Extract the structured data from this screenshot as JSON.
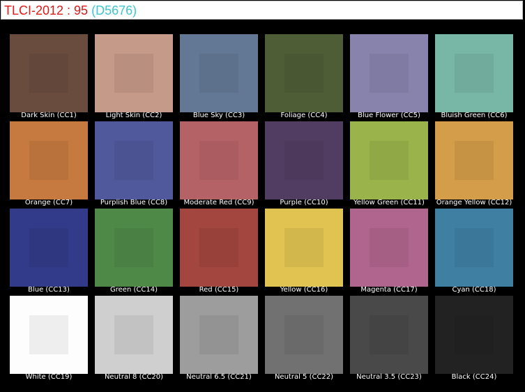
{
  "title": {
    "metric": "TLCI-2012 : 95",
    "source": "(D5676)",
    "metric_color": "#e01818",
    "source_color": "#3cc8d2"
  },
  "patches": [
    {
      "label": "Dark Skin (CC1)",
      "color": "#694c3e"
    },
    {
      "label": "Light Skin (CC2)",
      "color": "#c59a88"
    },
    {
      "label": "Blue Sky (CC3)",
      "color": "#637895"
    },
    {
      "label": "Foliage (CC4)",
      "color": "#4f5d37"
    },
    {
      "label": "Blue Flower (CC5)",
      "color": "#8883ad"
    },
    {
      "label": "Bluish Green (CC6)",
      "color": "#78b6a6"
    },
    {
      "label": "Orange (CC7)",
      "color": "#c67a40"
    },
    {
      "label": "Purplish Blue (CC8)",
      "color": "#51599d"
    },
    {
      "label": "Moderate Red (CC9)",
      "color": "#b56266"
    },
    {
      "label": "Purple (CC10)",
      "color": "#523d62"
    },
    {
      "label": "Yellow Green (CC11)",
      "color": "#9bb34b"
    },
    {
      "label": "Orange Yellow (CC12)",
      "color": "#d39d4a"
    },
    {
      "label": "Blue (CC13)",
      "color": "#313b89"
    },
    {
      "label": "Green (CC14)",
      "color": "#4f8948"
    },
    {
      "label": "Red (CC15)",
      "color": "#a2463f"
    },
    {
      "label": "Yellow (CC16)",
      "color": "#e0c351"
    },
    {
      "label": "Magenta (CC17)",
      "color": "#b0658e"
    },
    {
      "label": "Cyan (CC18)",
      "color": "#3e7fa2"
    },
    {
      "label": "White (CC19)",
      "color": "#fdfdfd"
    },
    {
      "label": "Neutral 8 (CC20)",
      "color": "#cfcfcf"
    },
    {
      "label": "Neutral 6.5 (CC21)",
      "color": "#9d9d9d"
    },
    {
      "label": "Neutral 5 (CC22)",
      "color": "#717171"
    },
    {
      "label": "Neutral 3.5 (CC23)",
      "color": "#494949"
    },
    {
      "label": "Black (CC24)",
      "color": "#222222"
    }
  ]
}
